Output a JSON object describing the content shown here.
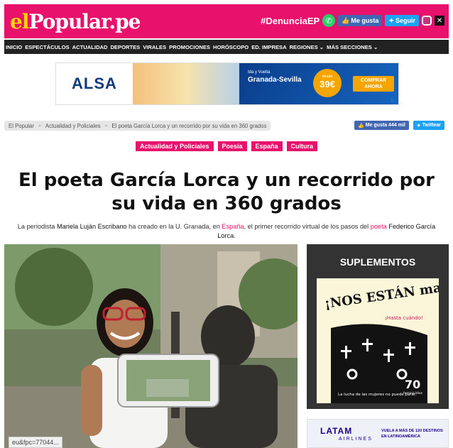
{
  "site": {
    "logo_el": "el",
    "logo_main": "Popular.pe",
    "hashtag": "#DenunciaEP",
    "like_label": "Me gusta",
    "follow_label": "Seguir",
    "brand_color": "#e8116b"
  },
  "nav": {
    "items": [
      "INICIO",
      "ESPECTÁCULOS",
      "ACTUALIDAD",
      "DEPORTES",
      "VIRALES",
      "PROMOCIONES",
      "HORÓSCOPO",
      "ED. IMPRESA",
      "REGIONES",
      "MÁS SECCIONES"
    ]
  },
  "ad": {
    "brand": "ALSA",
    "route_small": "Ida y Vuelta",
    "route": "Granada-Sevilla",
    "price_from": "desde",
    "price": "39€",
    "cta": "COMPRAR AHORA"
  },
  "breadcrumb": [
    "El Popular",
    "Actualidad y Policiales",
    "El poeta García Lorca y un recorrido por su vida en 360 grados"
  ],
  "share": {
    "fb_label": "Me gusta 444 mil",
    "tw_label": "Twittear"
  },
  "tags": [
    "Actualidad y Policiales",
    "Poesía",
    "España",
    "Cultura"
  ],
  "article": {
    "title": "El poeta García Lorca y un recorrido por su vida en 360 grados",
    "lead_1": "La periodista ",
    "lead_name": "Mariela Luján Escribano",
    "lead_2": " ha creado en la U. Granada, en ",
    "lead_country": "España",
    "lead_3": ", el primer recorrido virtual de los pasos del ",
    "lead_poet": "poeta",
    "lead_4": " ",
    "lead_person": "Federico García Lorca",
    "lead_5": "."
  },
  "status_url": "eu&fpc=77044...",
  "sidebar": {
    "title": "SUPLEMENTOS",
    "cover_headline": "¡NOS ESTÁN matando!",
    "cover_sub": "¡Hasta cuándo!",
    "cover_number": "70",
    "cover_number_sub": "feminicidios",
    "cover_caption": "La lucha de las mujeres no puede parar."
  },
  "latam_ad": {
    "logo": "LATAM",
    "airlines": "AIRLINES",
    "text": "VUELA A MÁS DE 120 DESTINOS EN LATINOAMÉRICA"
  }
}
